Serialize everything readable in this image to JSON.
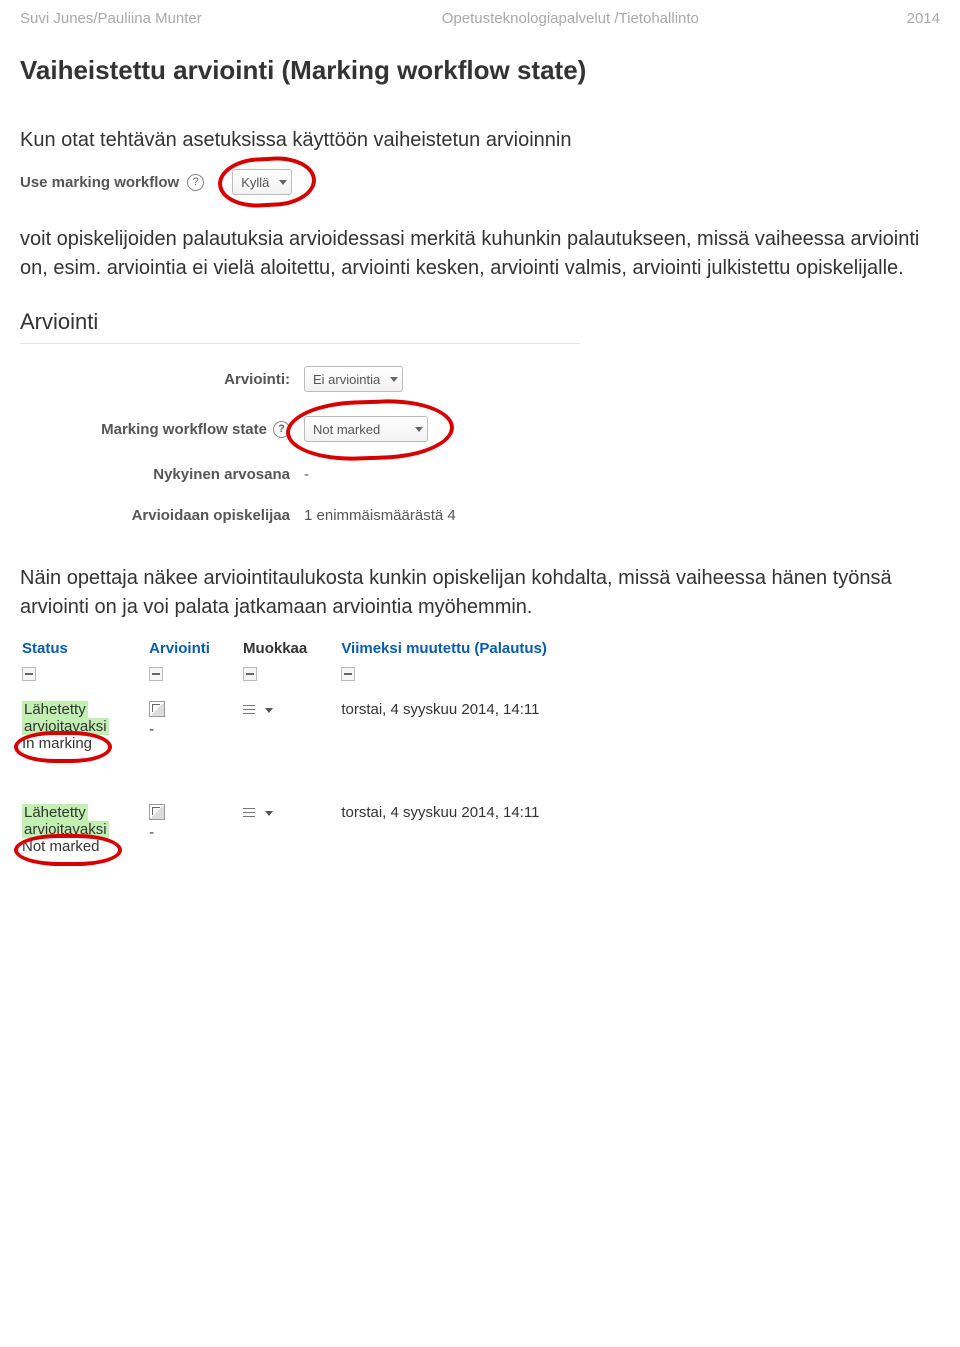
{
  "header": {
    "left": "Suvi Junes/Pauliina Munter",
    "center": "Opetusteknologiapalvelut /Tietohallinto",
    "right": "2014"
  },
  "title": "Vaiheistettu arviointi (Marking workflow state)",
  "para1": "Kun otat tehtävän asetuksissa käyttöön vaiheistetun arvioinnin",
  "shot1": {
    "label": "Use marking workflow",
    "value": "Kyllä"
  },
  "para2": "voit opiskelijoiden palautuksia arvioidessasi merkitä kuhunkin palautukseen, missä vaiheessa arviointi on, esim. arviointia ei vielä aloitettu, arviointi kesken, arviointi valmis, arviointi julkistettu opiskelijalle.",
  "shot2": {
    "heading": "Arviointi",
    "rows": {
      "arviointi_label": "Arviointi:",
      "arviointi_value": "Ei arviointia",
      "workflow_label": "Marking workflow state",
      "workflow_value": "Not marked",
      "current_label": "Nykyinen arvosana",
      "current_value": "-",
      "student_label": "Arvioidaan opiskelijaa",
      "student_value": "1 enimmäismäärästä 4"
    }
  },
  "para3": "Näin opettaja näkee arviointitaulukosta kunkin opiskelijan kohdalta, missä vaiheessa hänen työnsä arviointi on ja voi palata jatkamaan arviointia myöhemmin.",
  "table": {
    "headers": {
      "status": "Status",
      "arviointi": "Arviointi",
      "muokkaa": "Muokkaa",
      "viimeksi": "Viimeksi muutettu (Palautus)"
    },
    "rows": [
      {
        "status1": "Lähetetty",
        "status2": "arvioitavaksi",
        "state": "In marking",
        "arviointi": "-",
        "date": "torstai, 4 syyskuu 2014, 14:11"
      },
      {
        "status1": "Lähetetty",
        "status2": "arvioitavaksi",
        "state": "Not marked",
        "arviointi": "-",
        "date": "torstai, 4 syyskuu 2014, 14:11"
      }
    ]
  }
}
